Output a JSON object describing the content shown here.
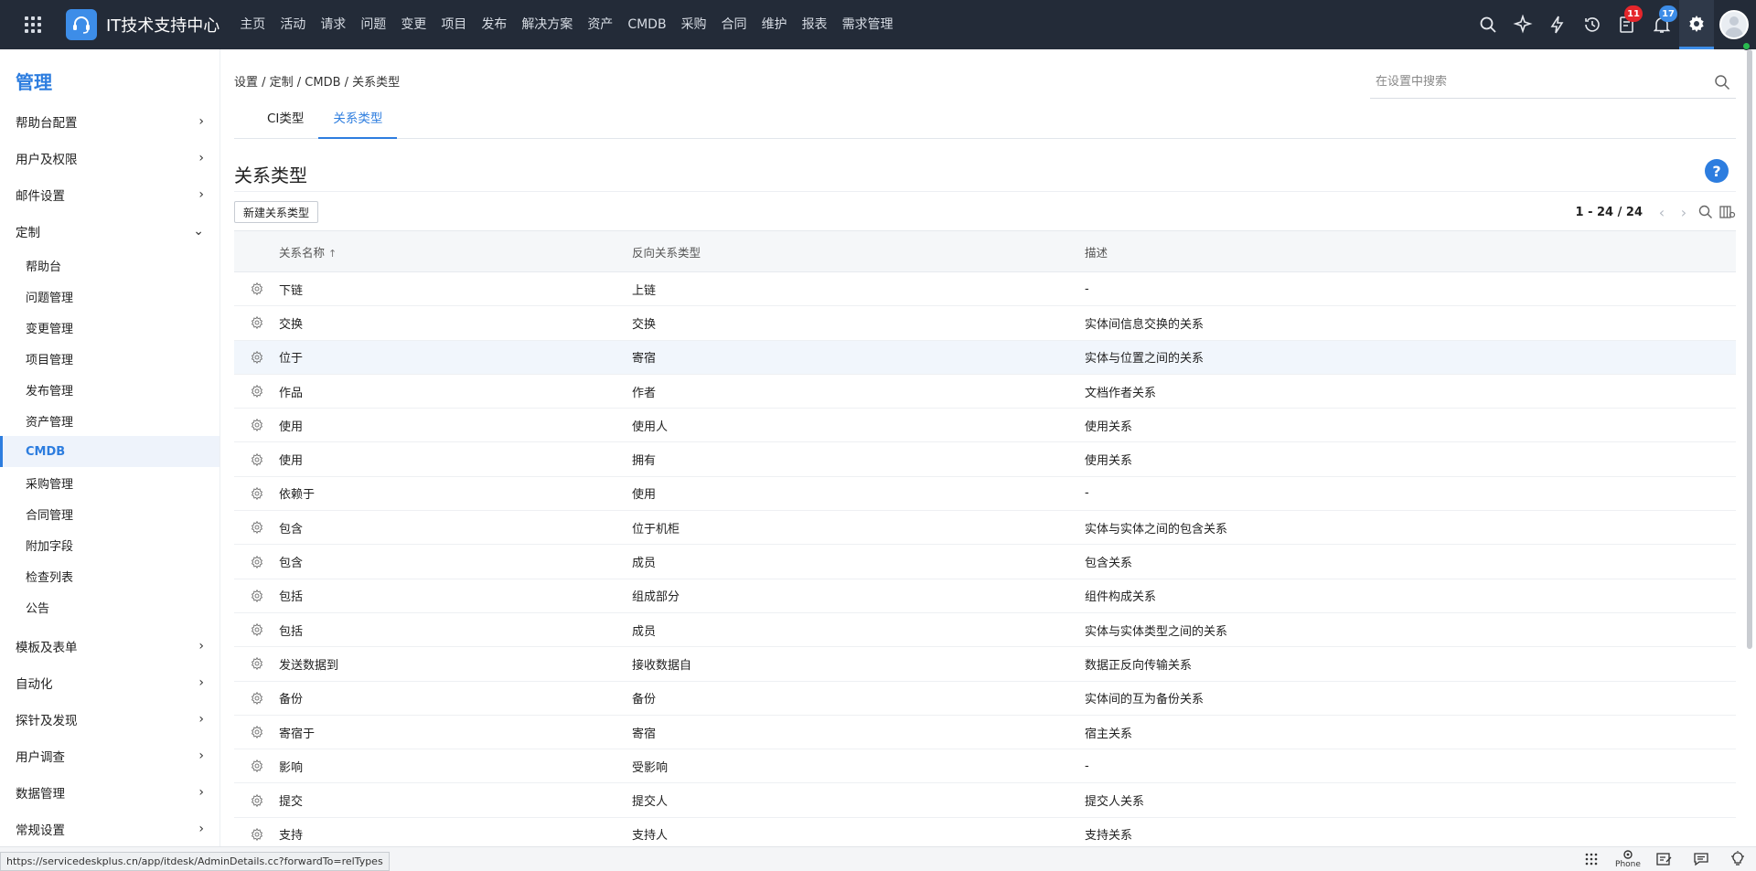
{
  "topbar": {
    "brand_title": "IT技术支持中心",
    "nav": [
      "主页",
      "活动",
      "请求",
      "问题",
      "变更",
      "项目",
      "发布",
      "解决方案",
      "资产",
      "CMDB",
      "采购",
      "合同",
      "维护",
      "报表",
      "需求管理"
    ],
    "badges": {
      "tasks": "11",
      "notifications": "17"
    }
  },
  "sidebar": {
    "title": "管理",
    "sections_top": [
      "帮助台配置",
      "用户及权限",
      "邮件设置"
    ],
    "expanded_section": "定制",
    "sub_items": [
      "帮助台",
      "问题管理",
      "变更管理",
      "项目管理",
      "发布管理",
      "资产管理",
      "CMDB",
      "采购管理",
      "合同管理",
      "附加字段",
      "检查列表",
      "公告"
    ],
    "active_sub_item": "CMDB",
    "sections_bottom": [
      "模板及表单",
      "自动化",
      "探针及发现",
      "用户调查",
      "数据管理",
      "常规设置"
    ]
  },
  "main": {
    "breadcrumb": "设置 / 定制 / CMDB / 关系类型",
    "search_placeholder": "在设置中搜索",
    "tabs": [
      {
        "label": "CI类型",
        "active": false
      },
      {
        "label": "关系类型",
        "active": true
      }
    ],
    "page_title": "关系类型",
    "help_label": "?",
    "new_button": "新建关系类型",
    "pagination": "1 - 24 / 24",
    "columns": [
      "关系名称",
      "反向关系类型",
      "描述"
    ],
    "rows": [
      [
        "下链",
        "上链",
        "-"
      ],
      [
        "交换",
        "交换",
        "实体间信息交换的关系"
      ],
      [
        "位于",
        "寄宿",
        "实体与位置之间的关系"
      ],
      [
        "作品",
        "作者",
        "文档作者关系"
      ],
      [
        "使用",
        "使用人",
        "使用关系"
      ],
      [
        "使用",
        "拥有",
        "使用关系"
      ],
      [
        "依赖于",
        "使用",
        "-"
      ],
      [
        "包含",
        "位于机柜",
        "实体与实体之间的包含关系"
      ],
      [
        "包含",
        "成员",
        "包含关系"
      ],
      [
        "包括",
        "组成部分",
        "组件构成关系"
      ],
      [
        "包括",
        "成员",
        "实体与实体类型之间的关系"
      ],
      [
        "发送数据到",
        "接收数据自",
        "数据正反向传输关系"
      ],
      [
        "备份",
        "备份",
        "实体间的互为备份关系"
      ],
      [
        "寄宿于",
        "寄宿",
        "宿主关系"
      ],
      [
        "影响",
        "受影响",
        "-"
      ],
      [
        "提交",
        "提交人",
        "提交人关系"
      ],
      [
        "支持",
        "支持人",
        "支持关系"
      ]
    ],
    "highlighted_row": 2
  },
  "statusbar": {
    "url": "https://servicedeskplus.cn/app/itdesk/AdminDetails.cc?forwardTo=relTypes",
    "phone_label": "Phone"
  }
}
